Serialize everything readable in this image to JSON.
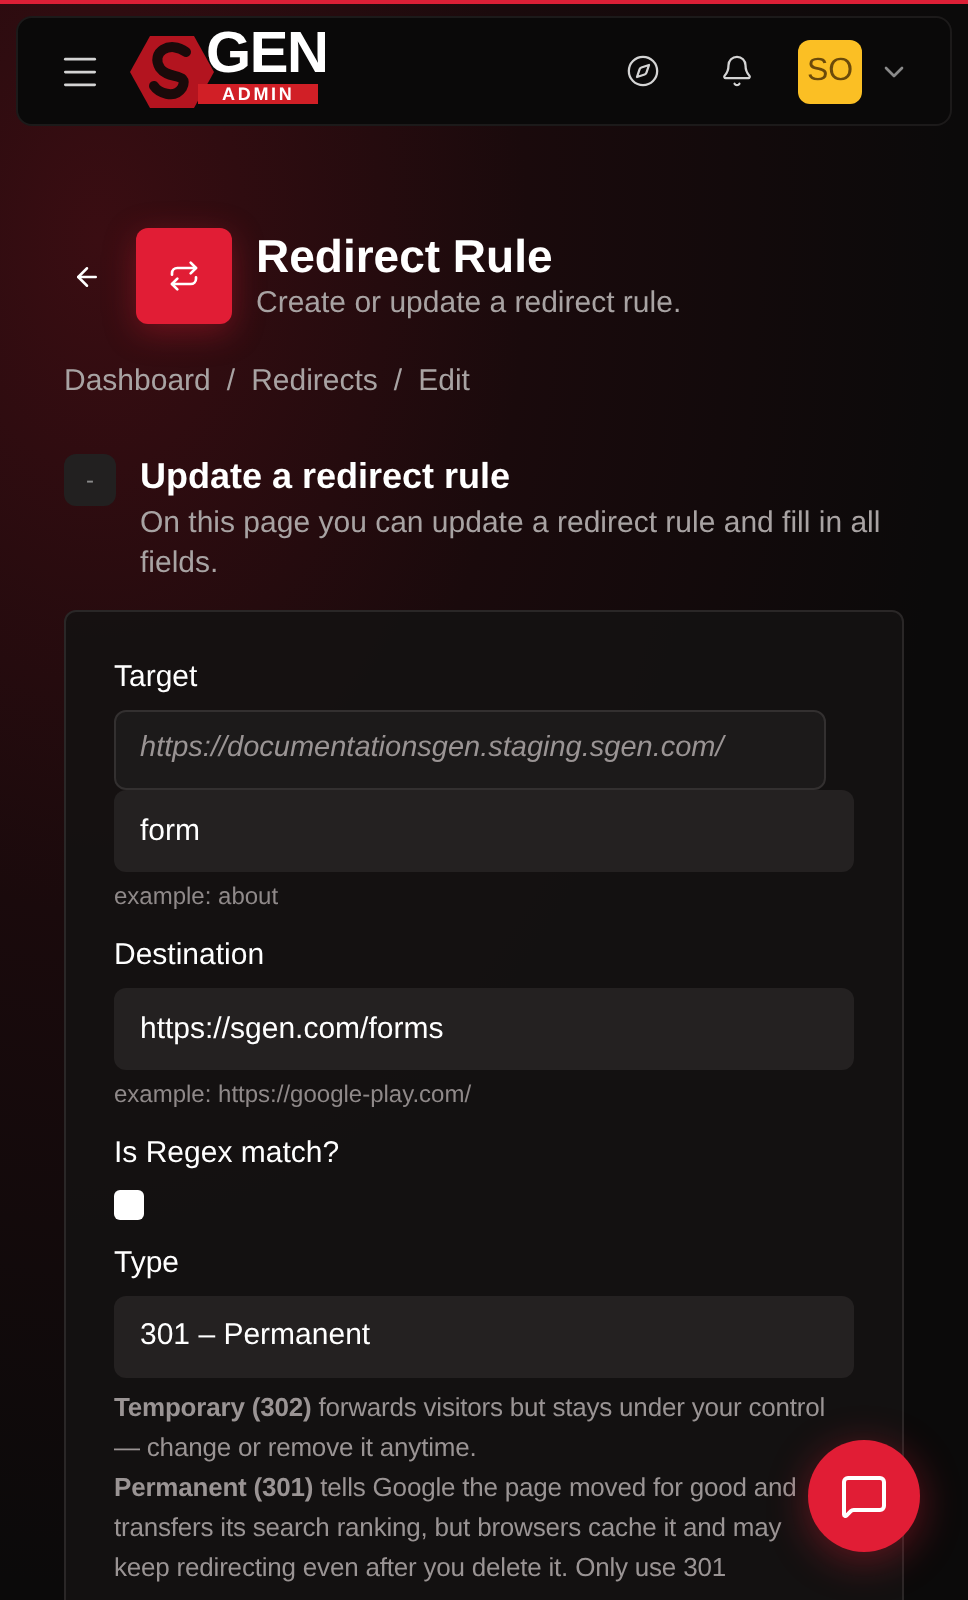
{
  "header": {
    "logo": {
      "word": "GEN",
      "tag": "ADMIN"
    },
    "avatar": "SO"
  },
  "page": {
    "title": "Redirect Rule",
    "subtitle": "Create or update a redirect rule."
  },
  "breadcrumbs": {
    "separator": "/",
    "items": [
      "Dashboard",
      "Redirects",
      "Edit"
    ]
  },
  "section": {
    "toggle": "-",
    "title": "Update a redirect rule",
    "description": "On this page you can update a redirect rule and fill in all fields."
  },
  "form": {
    "target": {
      "label": "Target",
      "prefix": "https://documentationsgen.staging.sgen.com/",
      "value": "form",
      "hint": "example: about"
    },
    "destination": {
      "label": "Destination",
      "value": "https://sgen.com/forms",
      "hint": "example: https://google-play.com/"
    },
    "regex": {
      "label": "Is Regex match?",
      "checked": false
    },
    "type": {
      "label": "Type",
      "value": "301 – Permanent",
      "help": [
        "**Temporary (302)** forwards visitors but stays under your control — change or remove it anytime.",
        "**Permanent (301)** tells Google the page moved for good and transfers its search ranking, but browsers cache it and may keep redirecting even after you delete it. Only use 301"
      ]
    }
  }
}
